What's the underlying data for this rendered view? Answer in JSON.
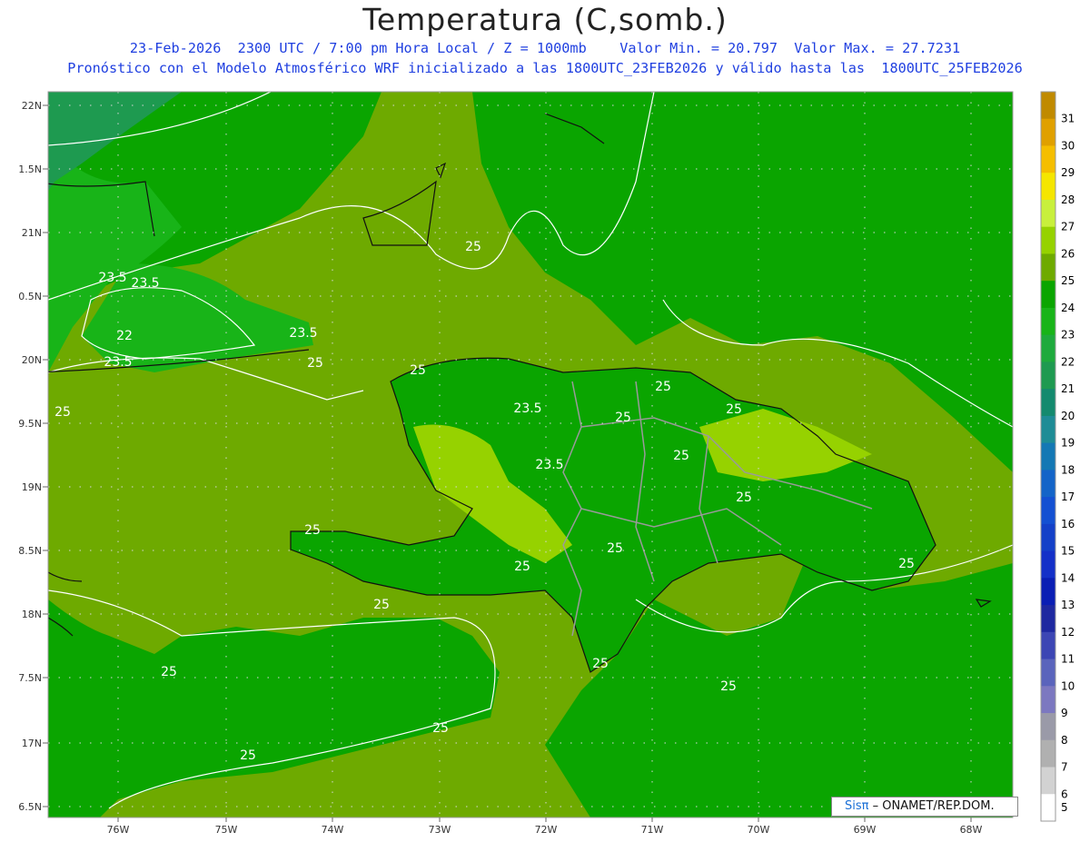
{
  "title": "Temperatura (C,somb.)",
  "subtitle_line1": "23-Feb-2026  2300 UTC / 7:00 pm Hora Local / Z = 1000mb    Valor Min. = 20.797  Valor Max. = 27.7231",
  "subtitle_line2": "Pronóstico con el Modelo Atmosférico WRF inicializado a las 1800UTC_23FEB2026 y válido hasta las  1800UTC_25FEB2026",
  "credit": {
    "brand": "Sisπ",
    "text": " – ONAMET/REP.DOM."
  },
  "lat_labels": [
    "22N",
    "1.5N",
    "21N",
    "0.5N",
    "20N",
    "9.5N",
    "19N",
    "8.5N",
    "18N",
    "7.5N",
    "17N",
    "6.5N"
  ],
  "lon_labels": [
    "76W",
    "75W",
    "74W",
    "73W",
    "72W",
    "71W",
    "70W",
    "69W",
    "68W"
  ],
  "contour_labels": [
    "25",
    "23.5",
    "23.5",
    "22",
    "23.5",
    "23.5",
    "25",
    "25",
    "25",
    "25",
    "23.5",
    "25",
    "25",
    "25",
    "23.5",
    "25",
    "25",
    "25",
    "25",
    "25",
    "25",
    "25",
    "25",
    "25",
    "25",
    "25"
  ],
  "colorbar": {
    "levels": [
      "31",
      "30",
      "29",
      "28",
      "27",
      "26",
      "25",
      "24",
      "23",
      "22",
      "21",
      "20",
      "19",
      "18",
      "17",
      "16",
      "15",
      "14",
      "13",
      "12",
      "11",
      "10",
      "9",
      "8",
      "7",
      "6",
      "5"
    ],
    "colors": [
      "#c08a00",
      "#e0a000",
      "#f5be00",
      "#f5e600",
      "#c8f03c",
      "#96d200",
      "#6eaa00",
      "#0aa500",
      "#18b418",
      "#1eaa3c",
      "#1e9a50",
      "#148a6e",
      "#1e8c96",
      "#1478b4",
      "#1464c8",
      "#1450d2",
      "#1440c8",
      "#1430c8",
      "#0a1eb4",
      "#1e28a0",
      "#3c46b4",
      "#5a64bc",
      "#7c78c0",
      "#9a9aa8",
      "#b0b0b0",
      "#d2d2d2",
      "#ffffff"
    ]
  },
  "fill_colors": {
    "sea": "#6eaa00",
    "warm": "#96d200",
    "cool": "#0aa500",
    "cooler": "#18b418",
    "coolest": "#1e9a50"
  }
}
